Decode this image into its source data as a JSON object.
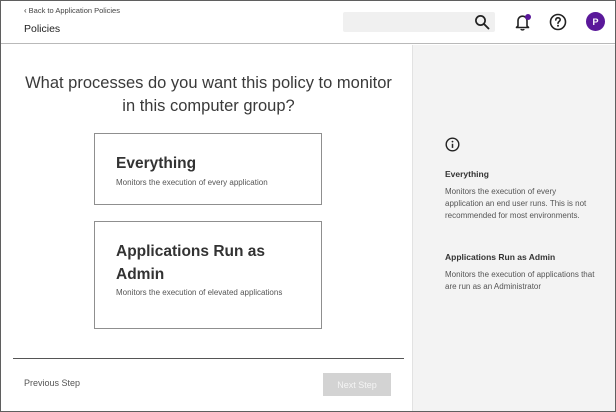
{
  "header": {
    "back_link": "Back to Application Policies",
    "title": "Policies",
    "search": {
      "placeholder": "",
      "value": ""
    },
    "avatar_initial": "P"
  },
  "main": {
    "question": "What processes do you want this policy to monitor in this computer group?",
    "options": [
      {
        "title": "Everything",
        "description": "Monitors the execution of every application"
      },
      {
        "title": "Applications Run as Admin",
        "description": "Monitors the execution of elevated applications"
      }
    ],
    "previous_step": "Previous Step",
    "next_step": "Next Step"
  },
  "side_panel": {
    "icon": "info-icon",
    "sections": [
      {
        "heading": "Everything",
        "text": "Monitors the execution of every application an end user runs. This is not recommended for most environments."
      },
      {
        "heading": "Applications Run as Admin",
        "text": "Monitors the execution of applications that are run as an Administrator"
      }
    ]
  },
  "colors": {
    "avatar_bg": "#5a189a",
    "side_panel_bg": "#f3f3f3",
    "disabled_button_bg": "#d3d3d3"
  }
}
